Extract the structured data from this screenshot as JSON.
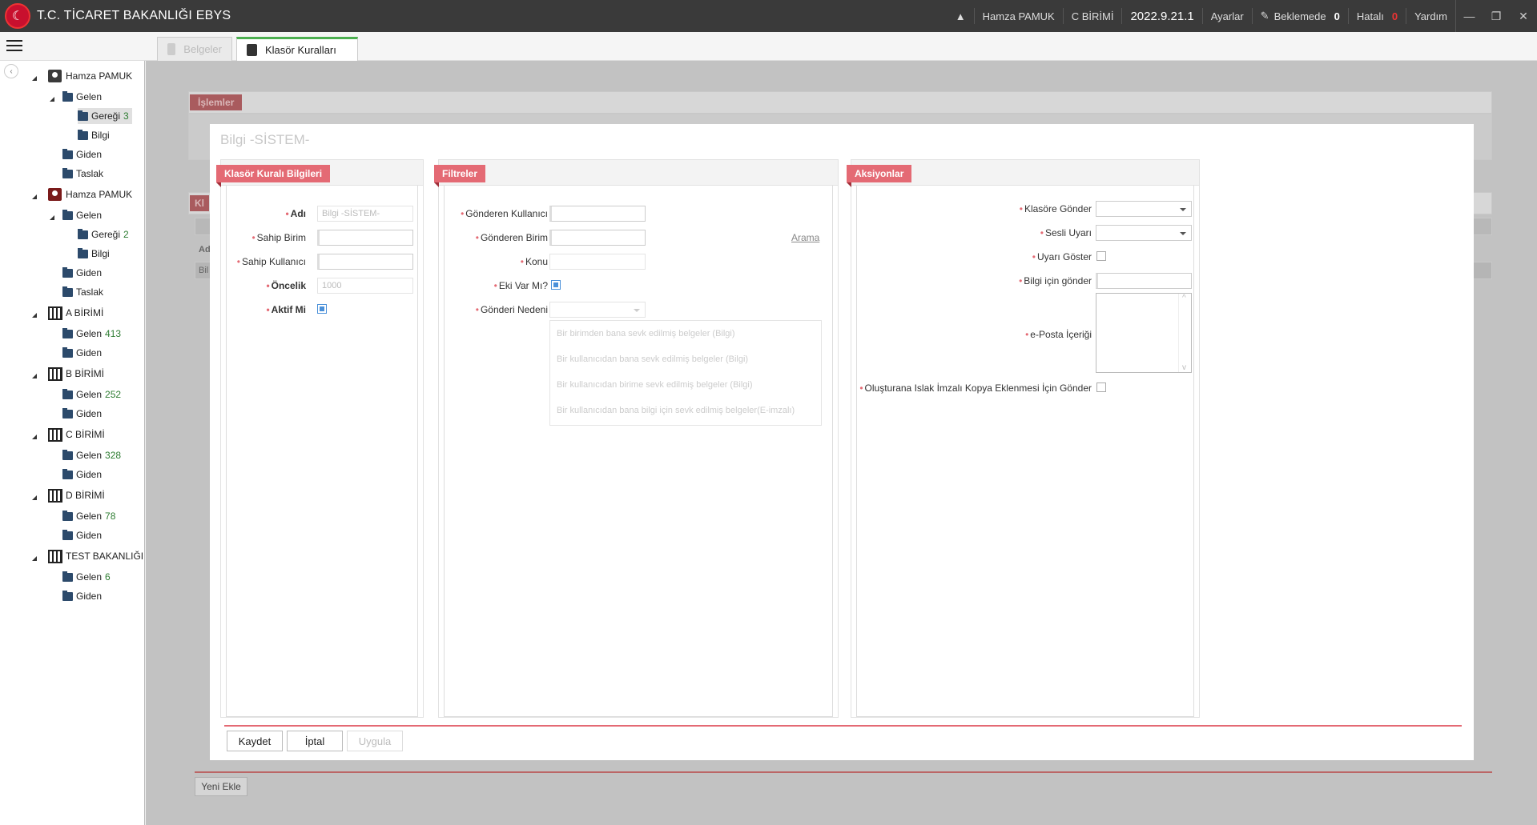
{
  "app": {
    "title": "T.C. TİCARET BAKANLIĞI EBYS",
    "logo": "☾"
  },
  "topbar": {
    "user": "Hamza PAMUK",
    "unit": "C BİRİMİ",
    "version": "2022.9.21.1",
    "settings": "Ayarlar",
    "pending_label": "Beklemede",
    "pending_count": "0",
    "error_label": "Hatalı",
    "error_count": "0",
    "help": "Yardım"
  },
  "tabs": [
    {
      "label": "Belgeler"
    },
    {
      "label": "Klasör Kuralları"
    }
  ],
  "tree": {
    "user1": "Hamza PAMUK",
    "gelen": "Gelen",
    "geregi": "Gereği",
    "bilgi": "Bilgi",
    "giden": "Giden",
    "taslak": "Taslak",
    "user1_geregi_count": "3",
    "user2": "Hamza PAMUK",
    "user2_geregi_count": "2",
    "unit_a": "A BİRİMİ",
    "unit_a_count": "413",
    "unit_b": "B BİRİMİ",
    "unit_b_count": "252",
    "unit_c": "C BİRİMİ",
    "unit_c_count": "328",
    "unit_d": "D BİRİMİ",
    "unit_d_count": "78",
    "unit_test": "TEST BAKANLIĞI",
    "unit_test_count": "6"
  },
  "background": {
    "islemler": "İşlemler",
    "kl": "Kl",
    "ad": "Ad",
    "bil": "Bil",
    "new_button": "Yeni Ekle"
  },
  "modal": {
    "title": "Bilgi -SİSTEM-",
    "rule_info": {
      "header": "Klasör Kuralı Bilgileri",
      "name_label": "Adı",
      "name_value": "Bilgi -SİSTEM-",
      "owner_unit_label": "Sahip Birim",
      "owner_user_label": "Sahip Kullanıcı",
      "priority_label": "Öncelik",
      "priority_value": "1000",
      "active_label": "Aktif Mi",
      "active": true
    },
    "filters": {
      "header": "Filtreler",
      "sender_user_label": "Gönderen Kullanıcı",
      "sender_unit_label": "Gönderen Birim",
      "search_link": "Arama",
      "subject_label": "Konu",
      "has_attachment_label": "Eki Var Mı?",
      "has_attachment": true,
      "reason_label": "Gönderi Nedeni",
      "reasons": [
        "Bir birimden bana sevk edilmiş belgeler (Bilgi)",
        "Bir kullanıcıdan bana sevk edilmiş belgeler (Bilgi)",
        "Bir kullanıcıdan birime sevk edilmiş belgeler (Bilgi)",
        "Bir kullanıcıdan bana bilgi için sevk edilmiş belgeler(E-imzalı)"
      ]
    },
    "actions": {
      "header": "Aksiyonlar",
      "send_folder_label": "Klasöre Gönder",
      "sound_alert_label": "Sesli Uyarı",
      "show_alert_label": "Uyarı Göster",
      "send_info_label": "Bilgi için gönder",
      "email_content_label": "e-Posta İçeriği",
      "wet_signed_copy_label": "Oluşturana Islak İmzalı Kopya Eklenmesi İçin Gönder"
    },
    "buttons": {
      "save": "Kaydet",
      "cancel": "İptal",
      "apply": "Uygula"
    }
  }
}
